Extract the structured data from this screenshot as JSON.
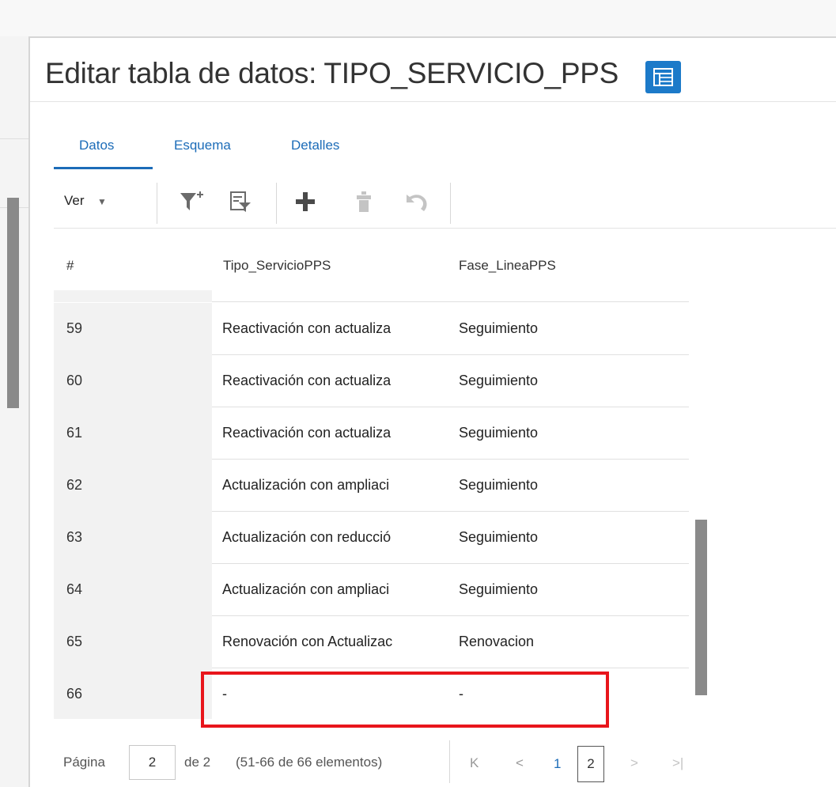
{
  "editor": {
    "title": "Editar tabla de datos: TIPO_SERVICIO_PPS",
    "title_icon": "table-icon",
    "accent_color": "#1c6cb8"
  },
  "tabs": [
    {
      "label": "Datos",
      "active": true
    },
    {
      "label": "Esquema",
      "active": false
    },
    {
      "label": "Detalles",
      "active": false
    }
  ],
  "toolbar": {
    "view_label": "Ver",
    "icons": [
      "add-filter-icon",
      "filter-rows-icon",
      "add-row-icon",
      "delete-row-icon",
      "undo-icon"
    ]
  },
  "grid": {
    "columns": [
      "#",
      "Tipo_ServicioPPS",
      "Fase_LineaPPS"
    ],
    "rows": [
      {
        "num": "59",
        "tipo": "Reactivación con actualiza",
        "fase": "Seguimiento"
      },
      {
        "num": "60",
        "tipo": "Reactivación con actualiza",
        "fase": "Seguimiento"
      },
      {
        "num": "61",
        "tipo": "Reactivación con actualiza",
        "fase": "Seguimiento"
      },
      {
        "num": "62",
        "tipo": "Actualización con ampliaci",
        "fase": "Seguimiento"
      },
      {
        "num": "63",
        "tipo": "Actualización con reducció",
        "fase": "Seguimiento"
      },
      {
        "num": "64",
        "tipo": "Actualización con ampliaci",
        "fase": "Seguimiento"
      },
      {
        "num": "65",
        "tipo": "Renovación con Actualizac",
        "fase": "Renovacion"
      },
      {
        "num": "66",
        "tipo": "-",
        "fase": "-"
      }
    ],
    "highlight_color": "#e8151b"
  },
  "pagination": {
    "page_label": "Página",
    "current_page": "2",
    "of_total": "de 2",
    "range_text": "(51-66 de 66 elementos)",
    "first_glyph": "K",
    "prev_glyph": "<",
    "next_glyph": ">",
    "last_glyph": ">|",
    "pages": [
      "1",
      "2"
    ]
  }
}
